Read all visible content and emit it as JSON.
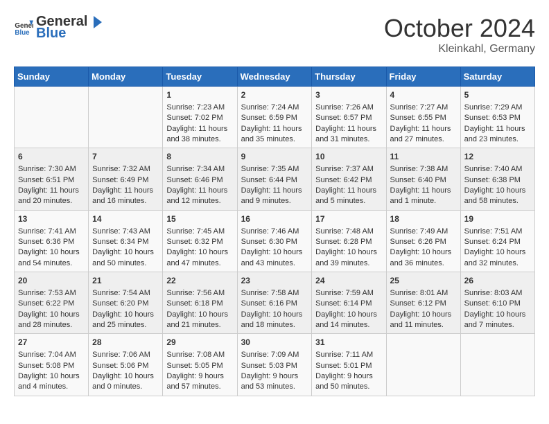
{
  "header": {
    "logo_general": "General",
    "logo_blue": "Blue",
    "month": "October 2024",
    "location": "Kleinkahl, Germany"
  },
  "days_of_week": [
    "Sunday",
    "Monday",
    "Tuesday",
    "Wednesday",
    "Thursday",
    "Friday",
    "Saturday"
  ],
  "weeks": [
    [
      {
        "day": "",
        "content": ""
      },
      {
        "day": "",
        "content": ""
      },
      {
        "day": "1",
        "sunrise": "Sunrise: 7:23 AM",
        "sunset": "Sunset: 7:02 PM",
        "daylight": "Daylight: 11 hours and 38 minutes."
      },
      {
        "day": "2",
        "sunrise": "Sunrise: 7:24 AM",
        "sunset": "Sunset: 6:59 PM",
        "daylight": "Daylight: 11 hours and 35 minutes."
      },
      {
        "day": "3",
        "sunrise": "Sunrise: 7:26 AM",
        "sunset": "Sunset: 6:57 PM",
        "daylight": "Daylight: 11 hours and 31 minutes."
      },
      {
        "day": "4",
        "sunrise": "Sunrise: 7:27 AM",
        "sunset": "Sunset: 6:55 PM",
        "daylight": "Daylight: 11 hours and 27 minutes."
      },
      {
        "day": "5",
        "sunrise": "Sunrise: 7:29 AM",
        "sunset": "Sunset: 6:53 PM",
        "daylight": "Daylight: 11 hours and 23 minutes."
      }
    ],
    [
      {
        "day": "6",
        "sunrise": "Sunrise: 7:30 AM",
        "sunset": "Sunset: 6:51 PM",
        "daylight": "Daylight: 11 hours and 20 minutes."
      },
      {
        "day": "7",
        "sunrise": "Sunrise: 7:32 AM",
        "sunset": "Sunset: 6:49 PM",
        "daylight": "Daylight: 11 hours and 16 minutes."
      },
      {
        "day": "8",
        "sunrise": "Sunrise: 7:34 AM",
        "sunset": "Sunset: 6:46 PM",
        "daylight": "Daylight: 11 hours and 12 minutes."
      },
      {
        "day": "9",
        "sunrise": "Sunrise: 7:35 AM",
        "sunset": "Sunset: 6:44 PM",
        "daylight": "Daylight: 11 hours and 9 minutes."
      },
      {
        "day": "10",
        "sunrise": "Sunrise: 7:37 AM",
        "sunset": "Sunset: 6:42 PM",
        "daylight": "Daylight: 11 hours and 5 minutes."
      },
      {
        "day": "11",
        "sunrise": "Sunrise: 7:38 AM",
        "sunset": "Sunset: 6:40 PM",
        "daylight": "Daylight: 11 hours and 1 minute."
      },
      {
        "day": "12",
        "sunrise": "Sunrise: 7:40 AM",
        "sunset": "Sunset: 6:38 PM",
        "daylight": "Daylight: 10 hours and 58 minutes."
      }
    ],
    [
      {
        "day": "13",
        "sunrise": "Sunrise: 7:41 AM",
        "sunset": "Sunset: 6:36 PM",
        "daylight": "Daylight: 10 hours and 54 minutes."
      },
      {
        "day": "14",
        "sunrise": "Sunrise: 7:43 AM",
        "sunset": "Sunset: 6:34 PM",
        "daylight": "Daylight: 10 hours and 50 minutes."
      },
      {
        "day": "15",
        "sunrise": "Sunrise: 7:45 AM",
        "sunset": "Sunset: 6:32 PM",
        "daylight": "Daylight: 10 hours and 47 minutes."
      },
      {
        "day": "16",
        "sunrise": "Sunrise: 7:46 AM",
        "sunset": "Sunset: 6:30 PM",
        "daylight": "Daylight: 10 hours and 43 minutes."
      },
      {
        "day": "17",
        "sunrise": "Sunrise: 7:48 AM",
        "sunset": "Sunset: 6:28 PM",
        "daylight": "Daylight: 10 hours and 39 minutes."
      },
      {
        "day": "18",
        "sunrise": "Sunrise: 7:49 AM",
        "sunset": "Sunset: 6:26 PM",
        "daylight": "Daylight: 10 hours and 36 minutes."
      },
      {
        "day": "19",
        "sunrise": "Sunrise: 7:51 AM",
        "sunset": "Sunset: 6:24 PM",
        "daylight": "Daylight: 10 hours and 32 minutes."
      }
    ],
    [
      {
        "day": "20",
        "sunrise": "Sunrise: 7:53 AM",
        "sunset": "Sunset: 6:22 PM",
        "daylight": "Daylight: 10 hours and 28 minutes."
      },
      {
        "day": "21",
        "sunrise": "Sunrise: 7:54 AM",
        "sunset": "Sunset: 6:20 PM",
        "daylight": "Daylight: 10 hours and 25 minutes."
      },
      {
        "day": "22",
        "sunrise": "Sunrise: 7:56 AM",
        "sunset": "Sunset: 6:18 PM",
        "daylight": "Daylight: 10 hours and 21 minutes."
      },
      {
        "day": "23",
        "sunrise": "Sunrise: 7:58 AM",
        "sunset": "Sunset: 6:16 PM",
        "daylight": "Daylight: 10 hours and 18 minutes."
      },
      {
        "day": "24",
        "sunrise": "Sunrise: 7:59 AM",
        "sunset": "Sunset: 6:14 PM",
        "daylight": "Daylight: 10 hours and 14 minutes."
      },
      {
        "day": "25",
        "sunrise": "Sunrise: 8:01 AM",
        "sunset": "Sunset: 6:12 PM",
        "daylight": "Daylight: 10 hours and 11 minutes."
      },
      {
        "day": "26",
        "sunrise": "Sunrise: 8:03 AM",
        "sunset": "Sunset: 6:10 PM",
        "daylight": "Daylight: 10 hours and 7 minutes."
      }
    ],
    [
      {
        "day": "27",
        "sunrise": "Sunrise: 7:04 AM",
        "sunset": "Sunset: 5:08 PM",
        "daylight": "Daylight: 10 hours and 4 minutes."
      },
      {
        "day": "28",
        "sunrise": "Sunrise: 7:06 AM",
        "sunset": "Sunset: 5:06 PM",
        "daylight": "Daylight: 10 hours and 0 minutes."
      },
      {
        "day": "29",
        "sunrise": "Sunrise: 7:08 AM",
        "sunset": "Sunset: 5:05 PM",
        "daylight": "Daylight: 9 hours and 57 minutes."
      },
      {
        "day": "30",
        "sunrise": "Sunrise: 7:09 AM",
        "sunset": "Sunset: 5:03 PM",
        "daylight": "Daylight: 9 hours and 53 minutes."
      },
      {
        "day": "31",
        "sunrise": "Sunrise: 7:11 AM",
        "sunset": "Sunset: 5:01 PM",
        "daylight": "Daylight: 9 hours and 50 minutes."
      },
      {
        "day": "",
        "content": ""
      },
      {
        "day": "",
        "content": ""
      }
    ]
  ]
}
